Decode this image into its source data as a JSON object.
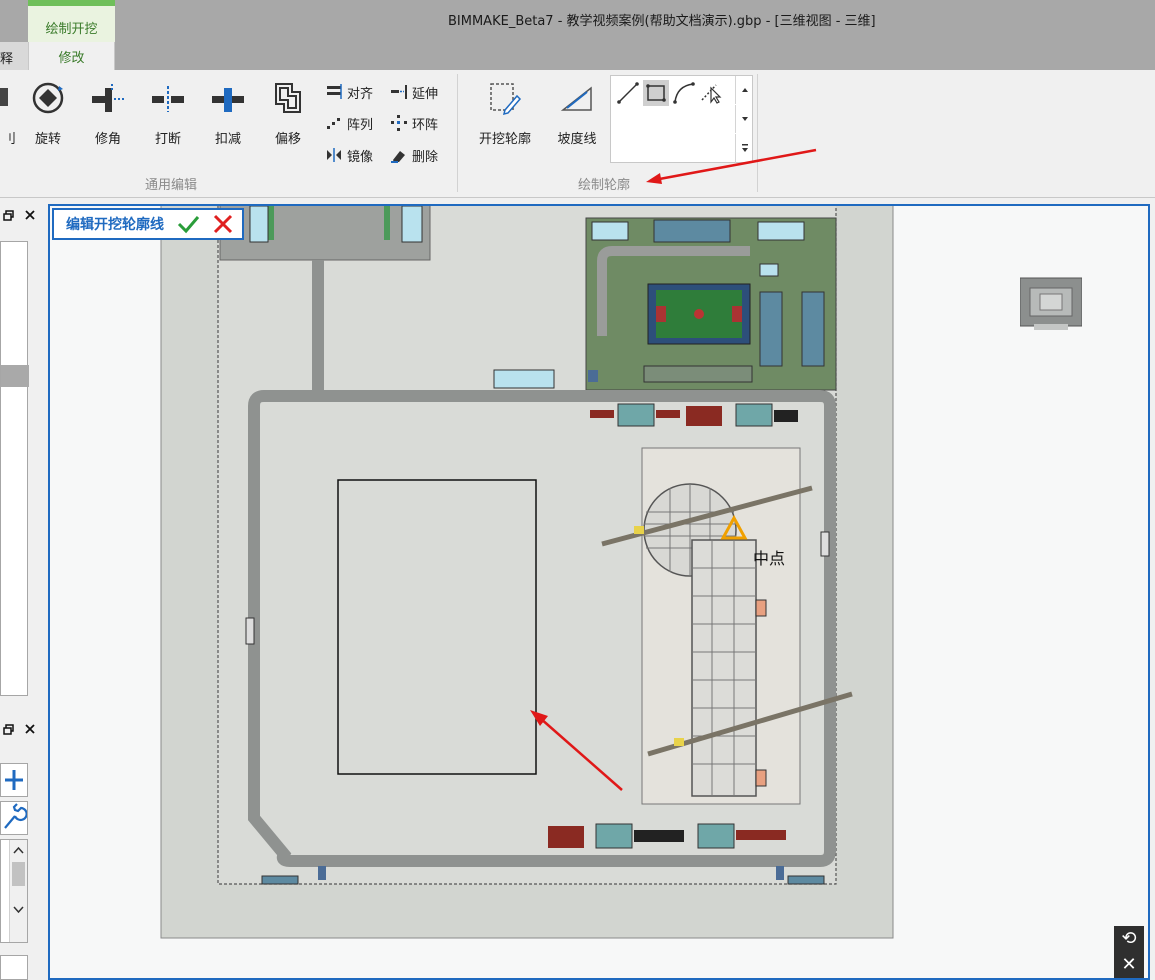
{
  "window": {
    "title": "BIMMAKE_Beta7 - 教学视频案例(帮助文档演示).gbp - [三维视图 - 三维]"
  },
  "tabs": {
    "context_group": "绘制开挖",
    "left_partial": "释",
    "active": "修改"
  },
  "ribbon": {
    "edit_group": {
      "label": "通用编辑",
      "left_partial": "刂",
      "buttons": [
        "旋转",
        "修角",
        "打断",
        "扣减",
        "偏移"
      ],
      "small_buttons": [
        "对齐",
        "延伸",
        "阵列",
        "环阵",
        "镜像",
        "删除"
      ]
    },
    "outline_group": {
      "label": "绘制轮廓",
      "buttons": [
        "开挖轮廓",
        "坡度线"
      ],
      "gallery_tools": [
        "line-tool-icon",
        "rectangle-tool-icon",
        "arc-tool-icon",
        "pick-tool-icon"
      ],
      "selected_tool": "rectangle-tool-icon"
    }
  },
  "edit_mode": {
    "title": "编辑开挖轮廓线"
  },
  "viewport": {
    "snap_label": "中点",
    "nav_controls": [
      "⟲",
      "✕"
    ]
  },
  "colors": {
    "accent_blue": "#1f6ac0",
    "ribbon_green": "#6fbf5a",
    "confirm_green": "#2a9d3a",
    "cancel_red": "#e02020",
    "annotation_arrow": "#e01818",
    "snap_marker": "#f0a000"
  }
}
